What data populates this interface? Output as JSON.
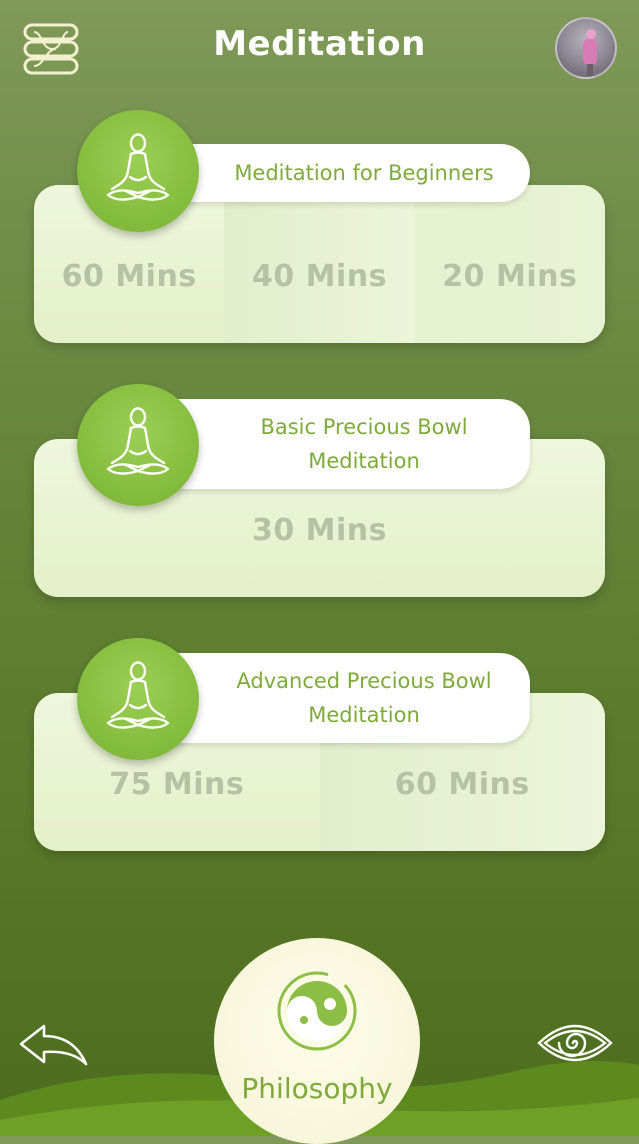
{
  "header": {
    "title": "Meditation",
    "menu_icon": "layers-menu-icon",
    "avatar_icon": "user-avatar"
  },
  "cards": [
    {
      "title": "Meditation for Beginners",
      "icon": "meditation-pose-icon",
      "options": [
        "60 Mins",
        "40 Mins",
        "20 Mins"
      ]
    },
    {
      "title": "Basic Precious Bowl Meditation",
      "icon": "meditation-pose-icon",
      "options": [
        "30 Mins"
      ]
    },
    {
      "title": "Advanced Precious Bowl Meditation",
      "icon": "meditation-pose-icon",
      "options": [
        "75 Mins",
        "60 Mins"
      ]
    }
  ],
  "footer": {
    "back_icon": "back-arrow-icon",
    "center_label": "Philosophy",
    "center_icon": "yin-yang-icon",
    "eye_icon": "eye-spiral-icon"
  },
  "colors": {
    "background_top": "#7f9a58",
    "background_bottom": "#4d6c1d",
    "accent_green": "#86be3f",
    "card": "#eef7dc",
    "text_green": "#7eaa3c",
    "option_text": "#b7c2a4"
  }
}
